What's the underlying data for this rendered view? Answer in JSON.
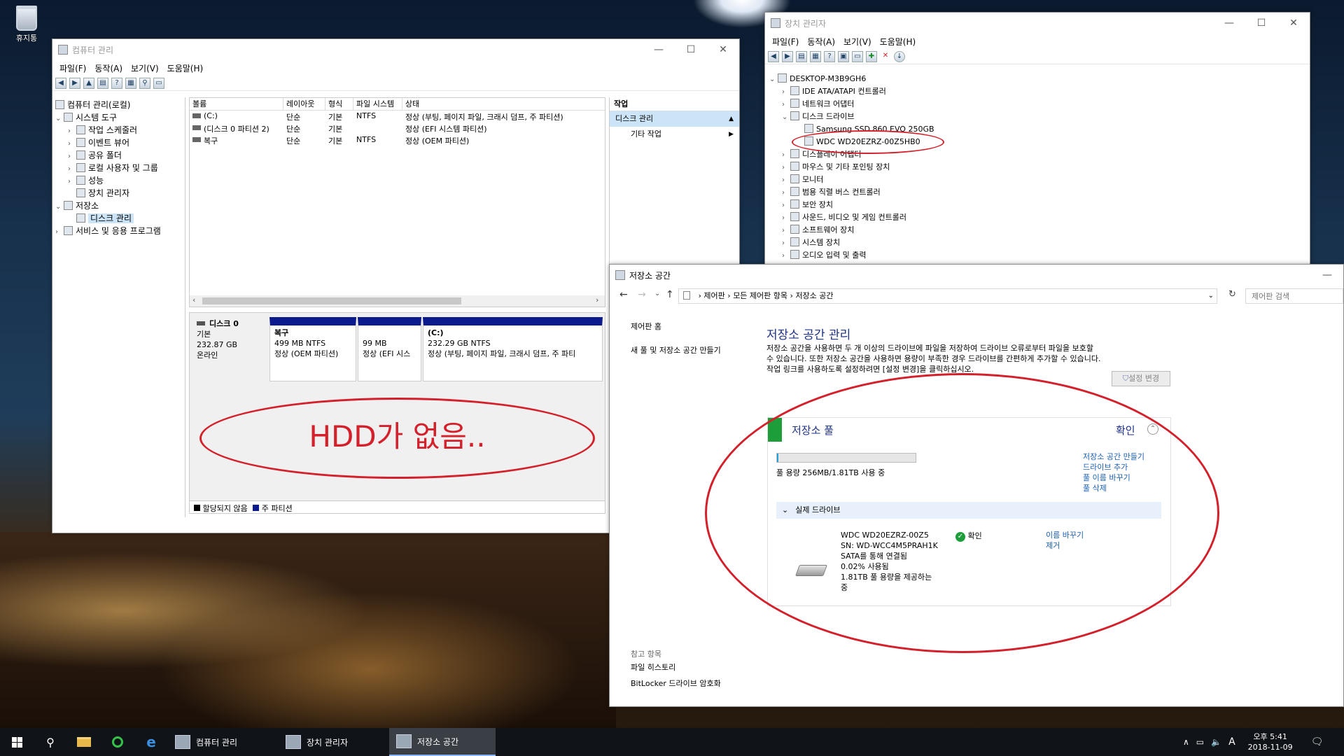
{
  "desktop": {
    "recycle_label": "휴지통"
  },
  "compmgmt": {
    "title": "컴퓨터 관리",
    "menu": [
      "파일(F)",
      "동작(A)",
      "보기(V)",
      "도움말(H)"
    ],
    "tree": [
      {
        "label": "컴퓨터 관리(로컬)",
        "level": 0,
        "exp": ""
      },
      {
        "label": "시스템 도구",
        "level": 1,
        "exp": "⌄"
      },
      {
        "label": "작업 스케줄러",
        "level": 2,
        "exp": "›"
      },
      {
        "label": "이벤트 뷰어",
        "level": 2,
        "exp": "›"
      },
      {
        "label": "공유 폴더",
        "level": 2,
        "exp": "›"
      },
      {
        "label": "로컬 사용자 및 그룹",
        "level": 2,
        "exp": "›"
      },
      {
        "label": "성능",
        "level": 2,
        "exp": "›"
      },
      {
        "label": "장치 관리자",
        "level": 2,
        "exp": ""
      },
      {
        "label": "저장소",
        "level": 1,
        "exp": "⌄"
      },
      {
        "label": "디스크 관리",
        "level": 2,
        "exp": "",
        "selected": true
      },
      {
        "label": "서비스 및 응용 프로그램",
        "level": 1,
        "exp": "›"
      }
    ],
    "columns": [
      "볼륨",
      "레이아웃",
      "형식",
      "파일 시스템",
      "상태"
    ],
    "volumes": [
      {
        "name": "(C:)",
        "layout": "단순",
        "type": "기본",
        "fs": "NTFS",
        "status": "정상 (부팅, 페이지 파일, 크래시 덤프, 주 파티션)"
      },
      {
        "name": "(디스크 0 파티션 2)",
        "layout": "단순",
        "type": "기본",
        "fs": "",
        "status": "정상 (EFI 시스템 파티션)"
      },
      {
        "name": "복구",
        "layout": "단순",
        "type": "기본",
        "fs": "NTFS",
        "status": "정상 (OEM 파티션)"
      }
    ],
    "disk": {
      "name": "디스크 0",
      "type": "기본",
      "size": "232.87 GB",
      "state": "온라인"
    },
    "partitions": [
      {
        "name": "복구",
        "size": "499 MB NTFS",
        "status": "정상 (OEM 파티션)"
      },
      {
        "name": "",
        "size": "99 MB",
        "status": "정상 (EFI 시스"
      },
      {
        "name": "(C:)",
        "size": "232.29 GB NTFS",
        "status": "정상 (부팅, 페이지 파일, 크래시 덤프, 주 파티"
      }
    ],
    "annotation": "HDD가 없음..",
    "legend_unalloc": "할당되지 않음",
    "legend_primary": "주 파티션",
    "actions_header": "작업",
    "actions_section": "디스크 관리",
    "actions_more": "기타 작업"
  },
  "devmgr": {
    "title": "장치 관리자",
    "menu": [
      "파일(F)",
      "동작(A)",
      "보기(V)",
      "도움말(H)"
    ],
    "root": "DESKTOP-M3B9GH6",
    "items": [
      {
        "label": "IDE ATA/ATAPI 컨트롤러",
        "level": 1,
        "exp": "›"
      },
      {
        "label": "네트워크 어댑터",
        "level": 1,
        "exp": "›"
      },
      {
        "label": "디스크 드라이브",
        "level": 1,
        "exp": "⌄"
      },
      {
        "label": "Samsung SSD 860 EVO 250GB",
        "level": 2,
        "exp": ""
      },
      {
        "label": "WDC WD20EZRZ-00Z5HB0",
        "level": 2,
        "exp": ""
      },
      {
        "label": "디스플레이 어댑터",
        "level": 1,
        "exp": "›"
      },
      {
        "label": "마우스 및 기타 포인팅 장치",
        "level": 1,
        "exp": "›"
      },
      {
        "label": "모니터",
        "level": 1,
        "exp": "›"
      },
      {
        "label": "범용 직렬 버스 컨트롤러",
        "level": 1,
        "exp": "›"
      },
      {
        "label": "보안 장치",
        "level": 1,
        "exp": "›"
      },
      {
        "label": "사운드, 비디오 및 게임 컨트롤러",
        "level": 1,
        "exp": "›"
      },
      {
        "label": "소프트웨어 장치",
        "level": 1,
        "exp": "›"
      },
      {
        "label": "시스템 장치",
        "level": 1,
        "exp": "›"
      },
      {
        "label": "오디오 입력 및 출력",
        "level": 1,
        "exp": "›"
      }
    ]
  },
  "storage": {
    "title": "저장소 공간",
    "breadcrumb": [
      "제어판",
      "모든 제어판 항목",
      "저장소 공간"
    ],
    "search_placeholder": "제어판 검색",
    "nav_home": "제어판 홈",
    "nav_new": "새 풀 및 저장소 공간 만들기",
    "heading": "저장소 공간 관리",
    "desc": "저장소 공간을 사용하면 두 개 이상의 드라이브에 파일을 저장하여 드라이브 오류로부터 파일을 보호할 수 있습니다. 또한 저장소 공간을 사용하면 용량이 부족한 경우 드라이브를 간편하게 추가할 수 있습니다. 작업 링크를 사용하도록 설정하려면 [설정 변경]을 클릭하십시오.",
    "change_settings": "설정 변경",
    "pool_title": "저장소 풀",
    "pool_status": "확인",
    "pool_usage": "풀 용량 256MB/1.81TB 사용 중",
    "pool_usage_fraction": 0.0001,
    "pool_links": [
      "저장소 공간 만들기",
      "드라이브 추가",
      "풀 이름 바꾸기",
      "풀 삭제"
    ],
    "physical_header": "실제 드라이브",
    "drive_lines": [
      "WDC WD20EZRZ-00Z5",
      "SN: WD-WCC4M5PRAH1K",
      "SATA를 통해 연결됨",
      "0.02% 사용됨",
      "1.81TB 풀 용량을 제공하는",
      "중"
    ],
    "drive_status": "확인",
    "drive_links": [
      "이름 바꾸기",
      "제거"
    ],
    "see_also": "참고 항목",
    "see_links": [
      "파일 히스토리",
      "BitLocker 드라이브 암호화"
    ]
  },
  "taskbar": {
    "apps": [
      "컴퓨터 관리",
      "장치 관리자",
      "저장소 공간"
    ],
    "ime": "A",
    "time": "오후 5:41",
    "date": "2018-11-09"
  },
  "colors": {
    "ring": "#d3202a",
    "partition_bar": "#0b1a8c",
    "pool_green": "#1e9e3a",
    "selection": "#cce4f7"
  }
}
